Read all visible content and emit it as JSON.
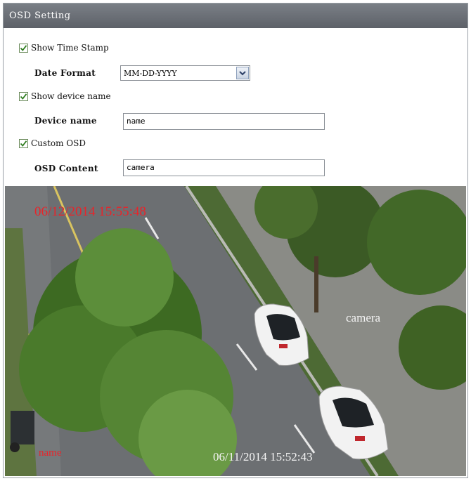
{
  "window": {
    "title": "OSD Setting"
  },
  "options": {
    "time_stamp": {
      "label": "Show Time Stamp",
      "checked": true
    },
    "date_format": {
      "label": "Date Format",
      "value": "MM-DD-YYYY"
    },
    "device_name": {
      "label": "Show device name",
      "checked": true
    },
    "device_name_field": {
      "label": "Device name",
      "value": "name"
    },
    "custom_osd": {
      "label": "Custom OSD",
      "checked": true
    },
    "osd_content_field": {
      "label": "OSD Content",
      "value": "camera"
    }
  },
  "preview": {
    "timestamp_top": "06/12/2014 15:55:48",
    "custom_text": "camera",
    "name_text": "name",
    "timestamp_bottom": "06/11/2014 15:52:43",
    "accent_red": "#e8242a"
  }
}
